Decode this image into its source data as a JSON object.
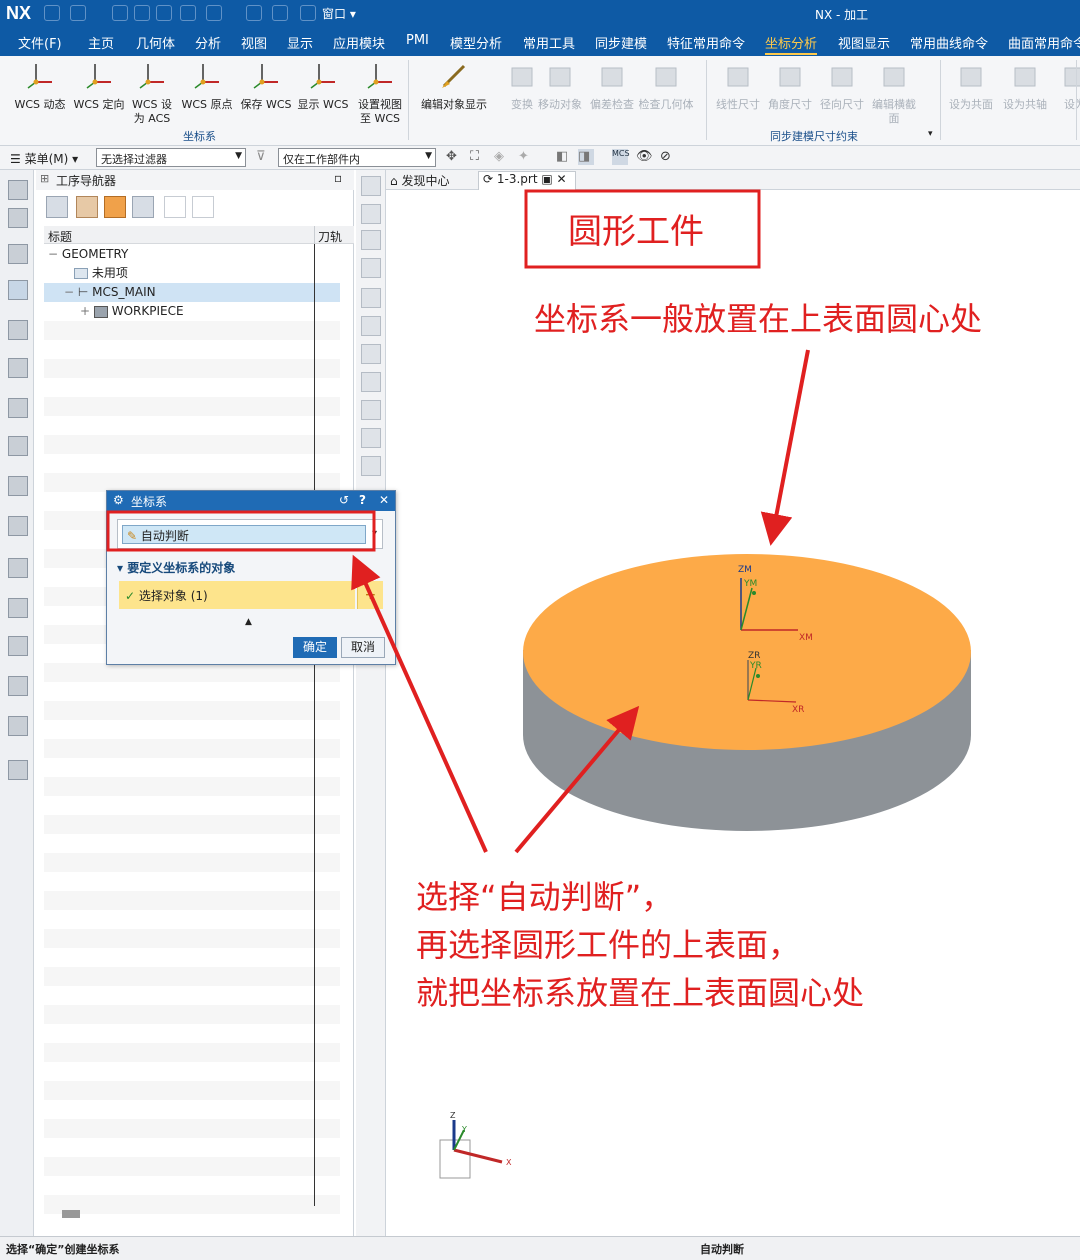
{
  "app": {
    "logo": "NX",
    "window_menu": "窗口",
    "window_title": "NX - 加工"
  },
  "menubar": {
    "items": [
      "文件(F)",
      "主页",
      "几何体",
      "分析",
      "视图",
      "显示",
      "应用模块",
      "PMI",
      "模型分析",
      "常用工具",
      "同步建模",
      "特征常用命令",
      "坐标分析",
      "视图显示",
      "常用曲线命令",
      "曲面常用命令"
    ],
    "active_index": 12
  },
  "ribbon": {
    "wcs_buttons": [
      {
        "line1": "WCS 动态",
        "line2": ""
      },
      {
        "line1": "WCS 定向",
        "line2": ""
      },
      {
        "line1": "WCS 设",
        "line2": "为 ACS"
      },
      {
        "line1": "WCS 原点",
        "line2": ""
      },
      {
        "line1": "保存 WCS",
        "line2": ""
      },
      {
        "line1": "显示 WCS",
        "line2": ""
      },
      {
        "line1": "设置视图",
        "line2": "至 WCS"
      }
    ],
    "group1_label": "坐标系",
    "edit_display": "编辑对象显示",
    "disabled_tools": [
      "变换",
      "移动对象",
      "偏差检查",
      "检查几何体"
    ],
    "sync_tools": [
      "线性尺寸",
      "角度尺寸",
      "径向尺寸",
      "编辑横截面"
    ],
    "group2_label": "同步建模尺寸约束",
    "extra_tools": [
      "设为共面",
      "设为共轴",
      "设为"
    ]
  },
  "toolbar2": {
    "menu_label": "菜单(M)",
    "filter_value": "无选择过滤器",
    "scope_value": "仅在工作部件内"
  },
  "navigator": {
    "title": "工序导航器",
    "col_title": "标题",
    "col_tool": "刀轨",
    "rows": [
      "GEOMETRY",
      "未用项",
      "MCS_MAIN",
      "WORKPIECE"
    ]
  },
  "tabs": {
    "discovery": "发现中心",
    "part": "1-3.prt"
  },
  "dialog": {
    "title": "坐标系",
    "type_value": "自动判断",
    "section_title": "要定义坐标系的对象",
    "select_label": "选择对象 (1)",
    "ok": "确定",
    "cancel": "取消"
  },
  "model": {
    "top_color": "#fdaa48",
    "side_color": "#8d9297",
    "axes": {
      "zm": "ZM",
      "ym": "YM",
      "xm": "XM",
      "zr": "ZR",
      "yr": "YR",
      "xr": "XR"
    },
    "triad": {
      "z": "Z",
      "y": "Y",
      "x": "X"
    }
  },
  "annotations": {
    "box_title": "圆形工件",
    "note_top": "坐标系一般放置在上表面圆心处",
    "note_line1": "选择“自动判断”，",
    "note_line2": "再选择圆形工件的上表面，",
    "note_line3": "就把坐标系放置在上表面圆心处",
    "color": "#e02020"
  },
  "status": {
    "left": "选择“确定”创建坐标系",
    "center": "自动判断"
  }
}
